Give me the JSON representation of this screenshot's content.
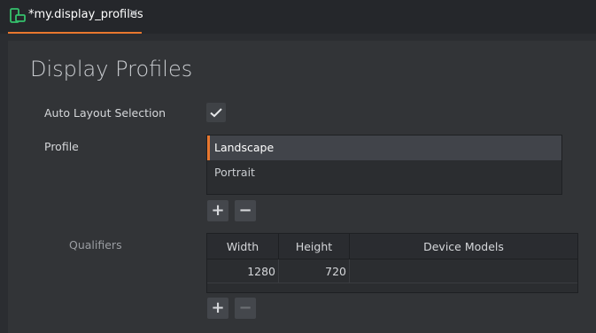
{
  "tab": {
    "title": "*my.display_profiles",
    "close_glyph": "✕",
    "icon": "display-profiles-icon",
    "accent": "#e8772e"
  },
  "page": {
    "title": "Display Profiles"
  },
  "form": {
    "auto_layout_label": "Auto Layout Selection",
    "auto_layout_checked": true,
    "profile_label": "Profile",
    "qualifiers_label": "Qualifiers"
  },
  "profiles": {
    "items": [
      "Landscape",
      "Portrait"
    ],
    "selected": "Landscape",
    "add_glyph": "+",
    "remove_glyph": "−"
  },
  "qualifiers": {
    "headers": [
      "Width",
      "Height",
      "Device Models"
    ],
    "rows": [
      [
        "1280",
        "720",
        ""
      ]
    ],
    "add_glyph": "+",
    "remove_glyph": "−",
    "remove_enabled": false
  }
}
